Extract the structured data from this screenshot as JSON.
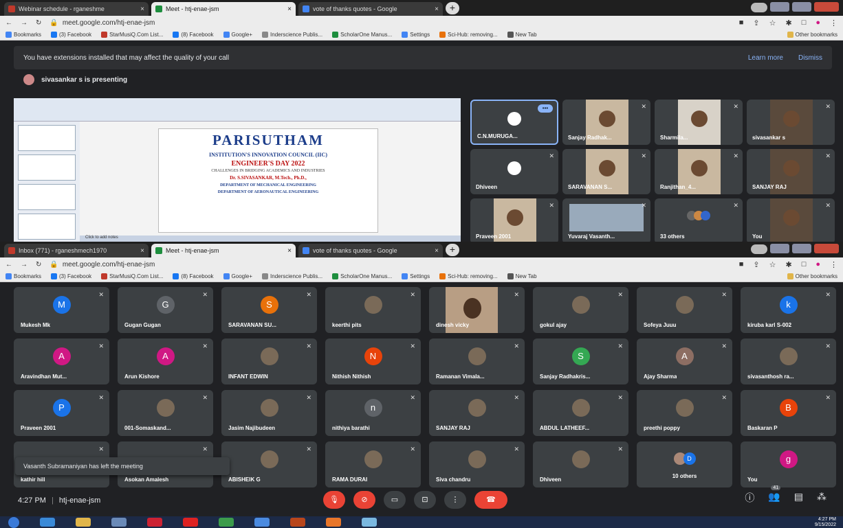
{
  "window1": {
    "tabs": [
      {
        "title": "Webinar schedule - rganeshme",
        "color": "#c0392b",
        "active": false
      },
      {
        "title": "Meet - htj-enae-jsm",
        "color": "#1e8e3e",
        "active": true
      },
      {
        "title": "vote of thanks quotes - Google",
        "color": "#4285f4",
        "active": false
      }
    ],
    "url": "meet.google.com/htj-enae-jsm",
    "bookmarks": [
      "Bookmarks",
      "(3) Facebook",
      "StarMusiQ.Com List...",
      "(8) Facebook",
      "Google+",
      "Inderscience Publis...",
      "ScholarOne Manus...",
      "Settings",
      "Sci-Hub: removing...",
      "New Tab",
      "Other bookmarks"
    ],
    "banner": {
      "text": "You have extensions installed that may affect the quality of your call",
      "learn": "Learn more",
      "dismiss": "Dismiss"
    },
    "presenting": "sivasankar s is presenting",
    "slide": {
      "title": "PARISUTHAM",
      "council": "INSTITUTION'S INNOVATION COUNCIL (IIC)",
      "event": "ENGINEER'S DAY 2022",
      "theme": "CHALLENGES IN BRIDGING ACADEMICS AND INDUSTRIES",
      "speaker": "Dr. S.SIVASANKAR, M.Tech., Ph.D.,",
      "dept1": "DEPARTMENT OF MECHANICAL ENGINEERING",
      "dept2": "DEPARTMENT OF AERONAUTICAL ENGINEERING",
      "notes": "Click to add notes"
    },
    "tiles": [
      {
        "name": "C.N.MURUGA...",
        "type": "avatar"
      },
      {
        "name": "Sanjay Radhak...",
        "type": "photo"
      },
      {
        "name": "Sharmila...",
        "type": "wall"
      },
      {
        "name": "sivasankar s",
        "type": "dark"
      },
      {
        "name": "Dhiveen",
        "type": "avatar"
      },
      {
        "name": "SARAVANAN S...",
        "type": "photo"
      },
      {
        "name": "Ranjithan_4...",
        "type": "photo"
      },
      {
        "name": "SANJAY RAJ",
        "type": "dark"
      },
      {
        "name": "Praveen 2001",
        "type": "photo"
      },
      {
        "name": "Yuvaraj Vasanth...",
        "type": "screen"
      },
      {
        "name": "33 others",
        "type": "others"
      },
      {
        "name": "You",
        "type": "dark"
      }
    ]
  },
  "window2": {
    "tabs": [
      {
        "title": "Inbox (771) - rganeshmech1970",
        "color": "#c0392b",
        "active": false
      },
      {
        "title": "Meet - htj-enae-jsm",
        "color": "#1e8e3e",
        "active": true
      },
      {
        "title": "vote of thanks quotes - Google",
        "color": "#4285f4",
        "active": false
      }
    ],
    "url": "meet.google.com/htj-enae-jsm",
    "bookmarks": [
      "Bookmarks",
      "(3) Facebook",
      "StarMusiQ.Com List...",
      "(8) Facebook",
      "Google+",
      "Inderscience Publis...",
      "ScholarOne Manus...",
      "Settings",
      "Sci-Hub: removing...",
      "New Tab",
      "Other bookmarks"
    ],
    "tiles": [
      {
        "name": "Mukesh Mk",
        "letter": "M",
        "color": "#1a73e8"
      },
      {
        "name": "Gugan Gugan",
        "letter": "G",
        "color": "#5f6368"
      },
      {
        "name": "SARAVANAN SU...",
        "letter": "S",
        "color": "#e8710a"
      },
      {
        "name": "keerthi pits",
        "letter": "",
        "color": "img"
      },
      {
        "name": "dinesh vicky",
        "letter": "",
        "color": "video"
      },
      {
        "name": "gokul ajay",
        "letter": "",
        "color": "img"
      },
      {
        "name": "Sofeya Juuu",
        "letter": "",
        "color": "img"
      },
      {
        "name": "kiruba karl S-002",
        "letter": "k",
        "color": "#1a73e8"
      },
      {
        "name": "Aravindhan Mut...",
        "letter": "A",
        "color": "#d01884"
      },
      {
        "name": "Arun Kishore",
        "letter": "A",
        "color": "#d01884"
      },
      {
        "name": "INFANT EDWIN",
        "letter": "",
        "color": "img"
      },
      {
        "name": "Nithish Nithish",
        "letter": "N",
        "color": "#e8430a"
      },
      {
        "name": "Ramanan Vimala...",
        "letter": "",
        "color": "img"
      },
      {
        "name": "Sanjay Radhakris...",
        "letter": "S",
        "color": "#34a853"
      },
      {
        "name": "Ajay Sharma",
        "letter": "A",
        "color": "#8d6e63"
      },
      {
        "name": "sivasanthosh ra...",
        "letter": "",
        "color": "img"
      },
      {
        "name": "Praveen 2001",
        "letter": "P",
        "color": "#1a73e8"
      },
      {
        "name": "001-Somaskand...",
        "letter": "",
        "color": "img"
      },
      {
        "name": "Jasim Najibudeen",
        "letter": "",
        "color": "img"
      },
      {
        "name": "nithiya barathi",
        "letter": "n",
        "color": "#5f6368"
      },
      {
        "name": "SANJAY RAJ",
        "letter": "",
        "color": "img"
      },
      {
        "name": "ABDUL LATHEEF...",
        "letter": "",
        "color": "img"
      },
      {
        "name": "preethi poppy",
        "letter": "",
        "color": "img"
      },
      {
        "name": "Baskaran P",
        "letter": "B",
        "color": "#e8430a"
      },
      {
        "name": "kathir hill",
        "letter": "",
        "color": "none"
      },
      {
        "name": "Asokan Amalesh",
        "letter": "",
        "color": "none"
      },
      {
        "name": "ABISHEIK G",
        "letter": "",
        "color": "img"
      },
      {
        "name": "RAMA DURAI",
        "letter": "",
        "color": "img"
      },
      {
        "name": "Siva chandru",
        "letter": "",
        "color": "img"
      },
      {
        "name": "Dhiveen",
        "letter": "",
        "color": "img"
      },
      {
        "name": "10 others",
        "letter": "D",
        "color": "others"
      },
      {
        "name": "You",
        "letter": "g",
        "color": "#d01884"
      }
    ],
    "toast": "Vasanth Subramaniyan has left the meeting",
    "time": "4:27 PM",
    "code": "htj-enae-jsm",
    "participants_count": "41",
    "clock_time": "4:27 PM",
    "clock_date": "9/15/2022"
  }
}
